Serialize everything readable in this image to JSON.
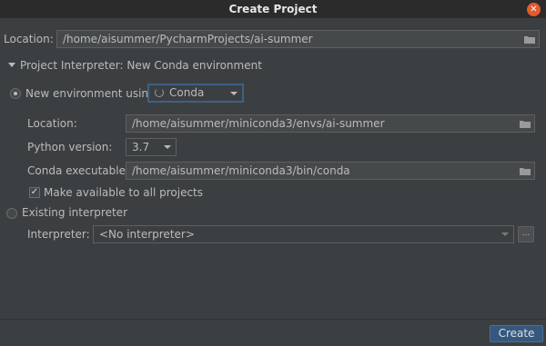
{
  "window": {
    "title": "Create Project",
    "close_glyph": "✕"
  },
  "project": {
    "location_label": "Location:",
    "location_value": "/home/aisummer/PycharmProjects/ai-summer"
  },
  "interpreter_section": {
    "header": "Project Interpreter: New Conda environment",
    "new_env": {
      "radio_label": "New environment using",
      "tool_selected": "Conda",
      "location_label": "Location:",
      "location_value": "/home/aisummer/miniconda3/envs/ai-summer",
      "python_version_label": "Python version:",
      "python_version_value": "3.7",
      "conda_exec_label": "Conda executable:",
      "conda_exec_value": "/home/aisummer/miniconda3/bin/conda",
      "make_available_label": "Make available to all projects",
      "make_available_checked": true
    },
    "existing": {
      "radio_label": "Existing interpreter",
      "interpreter_label": "Interpreter:",
      "interpreter_value": "<No interpreter>",
      "more_glyph": "..."
    }
  },
  "footer": {
    "create_label": "Create"
  },
  "colors": {
    "background": "#3c3f41",
    "titlebar": "#2b2b2b",
    "close_button": "#e25b2e",
    "primary_button": "#365880",
    "focus_border": "#3d6185"
  },
  "icons": [
    "close-icon",
    "folder-icon",
    "chevron-down-icon",
    "spinner-icon",
    "checkmark-icon",
    "radio-icon"
  ]
}
